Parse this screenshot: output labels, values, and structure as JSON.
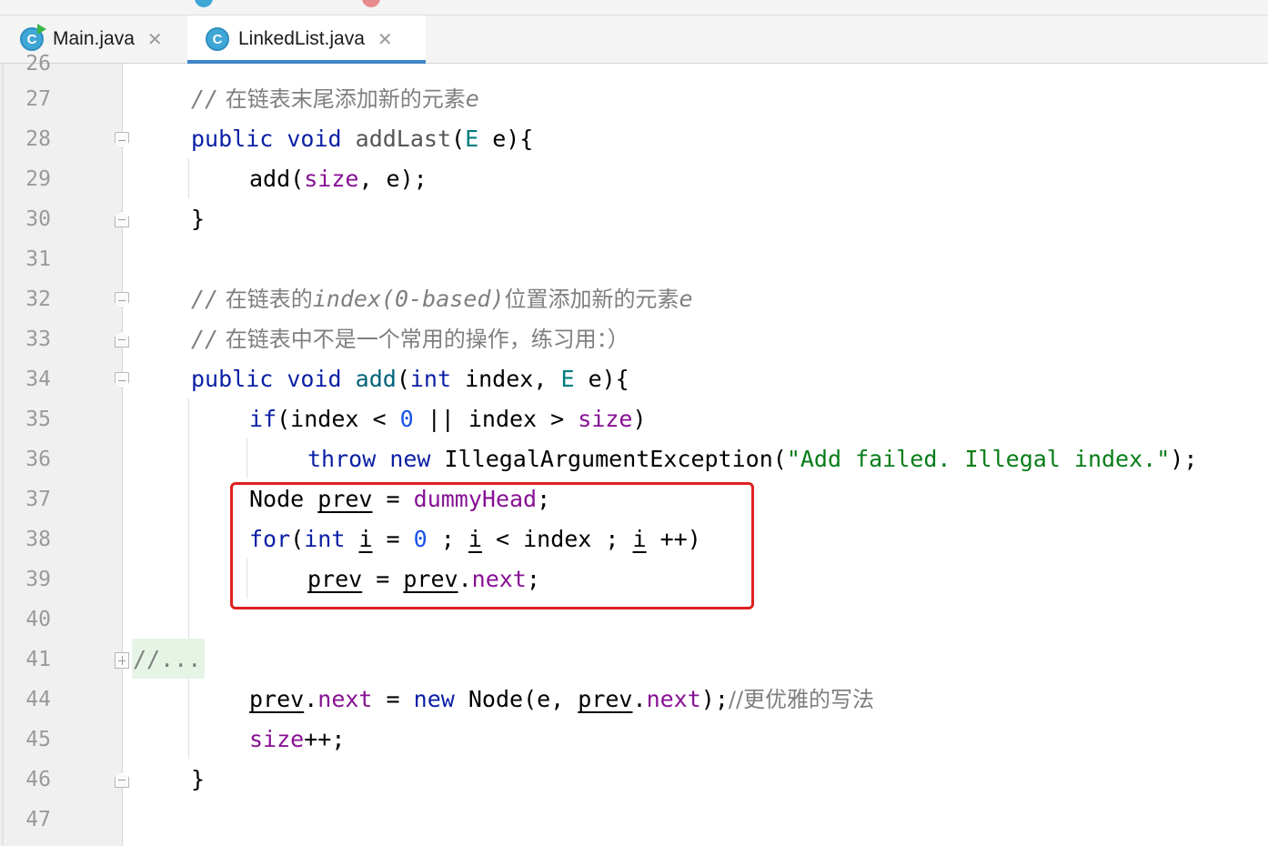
{
  "tabs": [
    {
      "label": "Main.java",
      "icon": "java-class-icon",
      "active": false
    },
    {
      "label": "LinkedList.java",
      "icon": "java-class-icon",
      "active": true
    }
  ],
  "tab_icon_letter": "C",
  "close_glyph": "✕",
  "partial_top_line_number": "26",
  "lines": [
    {
      "n": "27"
    },
    {
      "n": "28"
    },
    {
      "n": "29"
    },
    {
      "n": "30"
    },
    {
      "n": "31"
    },
    {
      "n": "32"
    },
    {
      "n": "33"
    },
    {
      "n": "34"
    },
    {
      "n": "35"
    },
    {
      "n": "36"
    },
    {
      "n": "37"
    },
    {
      "n": "38"
    },
    {
      "n": "39"
    },
    {
      "n": "40"
    },
    {
      "n": "41"
    },
    {
      "n": "44"
    },
    {
      "n": "45"
    },
    {
      "n": "46"
    },
    {
      "n": "47"
    }
  ],
  "code": {
    "l27": {
      "slashes": "//",
      "text_cn": " 在链表末尾添加新的元素",
      "tail": "e"
    },
    "l28": {
      "public": "public",
      "void": "void",
      "name": "addLast",
      "open": "(",
      "type": "E",
      "rest": " e){"
    },
    "l29": {
      "call": "add(",
      "field": "size",
      "rest": ", e);"
    },
    "l30": {
      "brace": "}"
    },
    "l32": {
      "slashes": "//",
      "text_cn1": " 在链表的",
      "mid": "index(0-based)",
      "text_cn2": "位置添加新的元素",
      "tail": "e"
    },
    "l33": {
      "slashes": "//",
      "text_cn": " 在链表中不是一个常用的操作，练习用：）"
    },
    "l34": {
      "public": "public",
      "void": "void",
      "name": "add",
      "open": "(",
      "int": "int",
      "p1": " index, ",
      "type": "E",
      "rest": " e){"
    },
    "l35": {
      "if": "if",
      "a": "(index < ",
      "zero": "0",
      "b": " || index > ",
      "field": "size",
      "c": ")"
    },
    "l36": {
      "throw": "throw",
      "new": "new",
      "cls": " IllegalArgumentException(",
      "str": "\"Add failed. Illegal index.\"",
      "end": ");"
    },
    "l37": {
      "type": "Node ",
      "var": "prev",
      "eq": " = ",
      "field": "dummyHead",
      "end": ";"
    },
    "l38": {
      "for": "for",
      "open": "(",
      "int": "int",
      "sp": " ",
      "i1": "i",
      "eq": " = ",
      "zero": "0",
      "semi1": " ; ",
      "i2": "i",
      "lt": " < index ; ",
      "i3": "i",
      "end": " ++)"
    },
    "l39": {
      "var1": "prev",
      "eq": " = ",
      "var2": "prev",
      "dot": ".",
      "field": "next",
      "end": ";"
    },
    "l41": {
      "folded": "//..."
    },
    "l44": {
      "var1": "prev",
      "dot1": ".",
      "field1": "next",
      "eq": " = ",
      "new": "new",
      "call": " Node(e, ",
      "var2": "prev",
      "dot2": ".",
      "field2": "next",
      "end": ");",
      "cmt": "//更优雅的写法"
    },
    "l45": {
      "field": "size",
      "end": "++;"
    },
    "l46": {
      "brace": "}"
    }
  },
  "colors": {
    "keyword": "#0b1fa5",
    "field": "#871094",
    "string": "#067d17",
    "comment": "#7f7f7f",
    "number": "#1750eb",
    "highlight_box": "#e02020",
    "active_tab_underline": "#4083c9"
  }
}
